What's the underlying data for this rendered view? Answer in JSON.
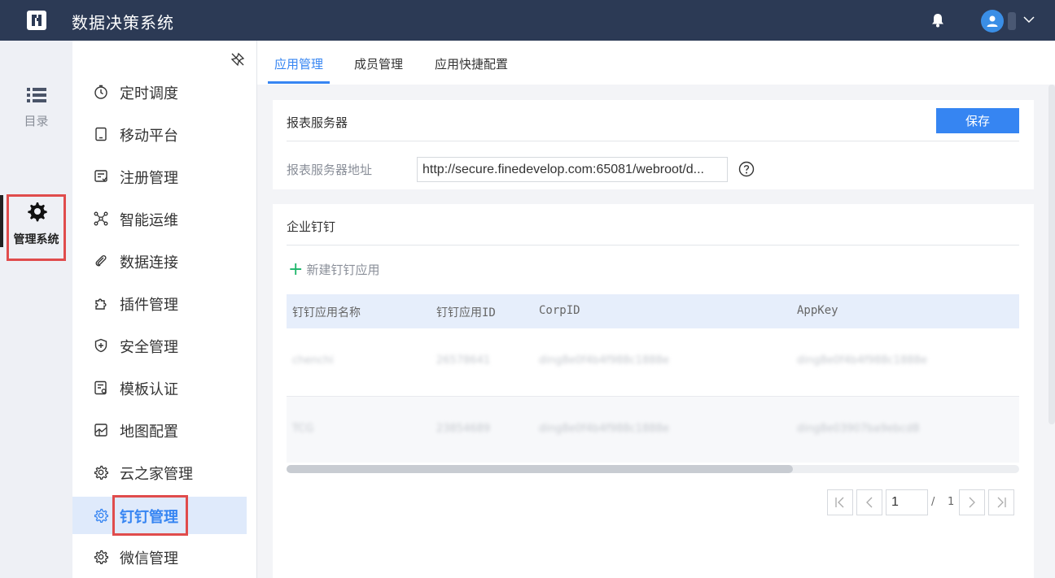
{
  "header": {
    "title": "数据决策系统"
  },
  "rail": {
    "directory_label": "目录",
    "system_label": "管理系统"
  },
  "menu": {
    "items": [
      {
        "label": "定时调度",
        "icon": "timer-icon"
      },
      {
        "label": "移动平台",
        "icon": "tablet-icon"
      },
      {
        "label": "注册管理",
        "icon": "register-icon"
      },
      {
        "label": "智能运维",
        "icon": "network-icon"
      },
      {
        "label": "数据连接",
        "icon": "paperclip-icon"
      },
      {
        "label": "插件管理",
        "icon": "puzzle-icon"
      },
      {
        "label": "安全管理",
        "icon": "shield-icon"
      },
      {
        "label": "模板认证",
        "icon": "template-icon"
      },
      {
        "label": "地图配置",
        "icon": "map-icon"
      },
      {
        "label": "云之家管理",
        "icon": "gear-icon"
      },
      {
        "label": "钉钉管理",
        "icon": "gear-icon",
        "active": true
      },
      {
        "label": "微信管理",
        "icon": "gear-icon"
      }
    ]
  },
  "tabs": [
    {
      "label": "应用管理",
      "active": true
    },
    {
      "label": "成员管理"
    },
    {
      "label": "应用快捷配置"
    }
  ],
  "server_card": {
    "title": "报表服务器",
    "save_label": "保存",
    "field_label": "报表服务器地址",
    "field_value": "http://secure.finedevelop.com:65081/webroot/d..."
  },
  "dingtalk_card": {
    "title": "企业钉钉",
    "new_label": "新建钉钉应用",
    "columns": [
      "钉钉应用名称",
      "钉钉应用ID",
      "CorpID",
      "AppKey"
    ],
    "rows": [
      [
        "chenchi",
        "26578641",
        "ding8e0f4b4f988c1888e",
        "ding8e0f4b4f988c1888e"
      ],
      [
        "TCG",
        "23854689",
        "ding8e0f4b4f988c1888e",
        "ding8e03907ba9ebcd8"
      ]
    ]
  },
  "pagination": {
    "current": "1",
    "separator": "/",
    "total": "1"
  },
  "colors": {
    "topbar": "#2c3a55",
    "accent": "#3685f2",
    "highlight": "#e04c4c",
    "plus": "#1cb56a"
  }
}
